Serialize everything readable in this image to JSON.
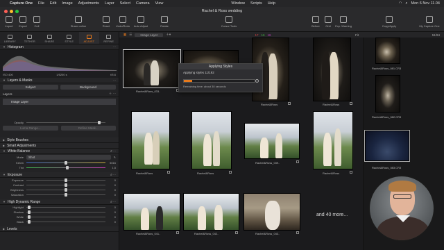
{
  "menubar": {
    "app": "Capture One",
    "items": [
      "File",
      "Edit",
      "Image",
      "Adjustments",
      "Layer",
      "Select",
      "Camera",
      "View"
    ],
    "right_items": [
      "Window",
      "Scripts",
      "Help"
    ],
    "clock": "Mon 6 Nov  11.04"
  },
  "window": {
    "title": "Rachel & Ross wedding"
  },
  "toolbar": {
    "left": [
      "Import",
      "Export",
      "Cull",
      "Share online",
      "Reset",
      "Undo/Redo",
      "Auto Adjust",
      "Rotate"
    ],
    "center_label": "Cursor Tools",
    "right": [
      "Before",
      "Grid",
      "Exp. Warning",
      "Copy/Apply",
      "My Capture One"
    ]
  },
  "tooltabs": [
    "LIBRARY",
    "TETHER",
    "SHARE",
    "STYLE",
    "ADJUST",
    "REFINE"
  ],
  "histogram": {
    "title": "Histogram",
    "iso": "ISO 400",
    "shutter": "1/5200 s",
    "aperture": "f/5.6"
  },
  "layers": {
    "title": "Layers & Masks",
    "subject_btn": "Subject",
    "background_btn": "Background",
    "layers_label": "Layers",
    "image_layer": "Image Layer",
    "opacity_label": "Opacity",
    "luma_range": "Luma Range...",
    "refine_mask": "Refine Mask..."
  },
  "sections": {
    "style_brushes": "Style Brushes",
    "smart_adjustments": "Smart Adjustments",
    "white_balance": "White Balance",
    "exposure": "Exposure",
    "hdr": "High Dynamic Range",
    "levels": "Levels"
  },
  "white_balance": {
    "mode_label": "Mode",
    "mode_value": "Shot",
    "kelvin_label": "Kelvin",
    "kelvin_value": "5016",
    "tint_label": "Tint",
    "tint_value": "1,5"
  },
  "exposure_sliders": [
    {
      "label": "Exposure",
      "value": "0"
    },
    {
      "label": "Contrast",
      "value": "0"
    },
    {
      "label": "Brightness",
      "value": "0"
    },
    {
      "label": "Saturation",
      "value": "0"
    }
  ],
  "hdr_sliders": [
    {
      "label": "Highlight",
      "value": "0"
    },
    {
      "label": "Shadow",
      "value": "0"
    },
    {
      "label": "White",
      "value": "0"
    },
    {
      "label": "Black",
      "value": "0"
    }
  ],
  "browser": {
    "layer_chip": "Image Layer",
    "fit_label": "Fit",
    "count_label": "51/94",
    "color_tags": [
      "17",
      "16",
      "16"
    ]
  },
  "grid_captions": {
    "r1c1": "Rachel&Ross_033..",
    "r1c3": "Rachel&Ross",
    "r1c4": "Rachel&Ross",
    "r2c1": "Rachel&Ross",
    "r2c2": "Rachel&Ross",
    "r2c3": "Rachel&Ross_039..",
    "r2c4": "Rachel&Ross",
    "r3c1": "Rachel&Ross_041..",
    "r3c2": "Rachel&Ross_042..",
    "r3c3": "Rachel&Ross_043.."
  },
  "viewer_captions": [
    "Rachel&Ross_081.CR3",
    "Rachel&Ross_082.CR3",
    "Rachel&Ross_083.CR3"
  ],
  "dialog": {
    "title": "Applying Styles",
    "message": "Applying styles 11/192",
    "remaining": "Remaining time: about 30 seconds",
    "progress": 0.12
  },
  "overlay_text": "and 40 more...",
  "colors": {
    "accent": "#e87a1c"
  }
}
